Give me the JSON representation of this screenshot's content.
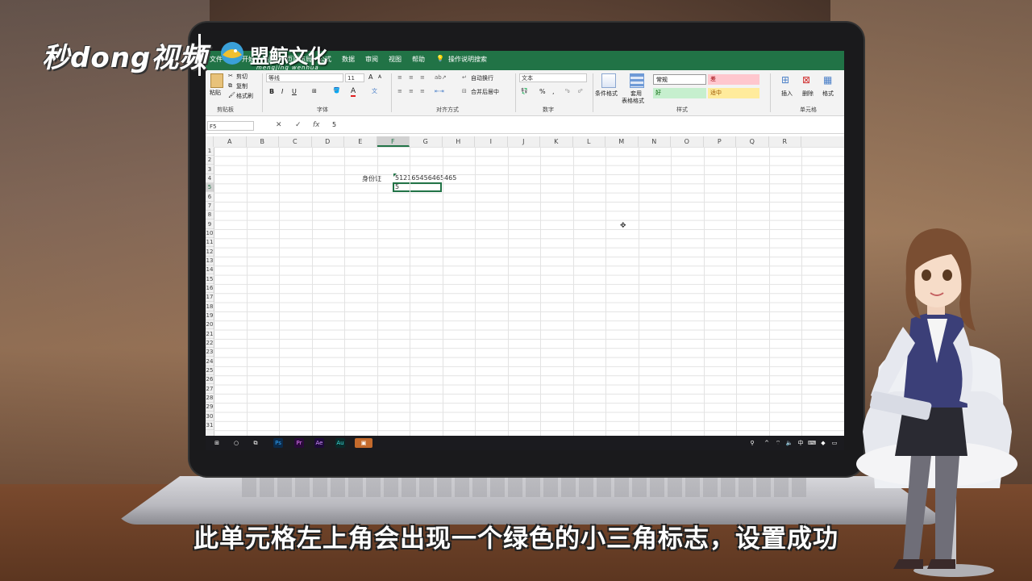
{
  "overlay": {
    "channel_logo": "秒dong视频",
    "brand_name": "盟鲸文化",
    "brand_sub": "mengjing wenhua",
    "subtitle": "此单元格左上角会出现一个绿色的小三角标志，设置成功"
  },
  "excel": {
    "tabs": [
      "文件",
      "开始",
      "插入",
      "页面布局",
      "公式",
      "数据",
      "审阅",
      "视图",
      "帮助"
    ],
    "tell_me": "操作说明搜索",
    "clipboard": {
      "paste": "粘贴",
      "cut": "剪切",
      "copy": "复制",
      "format_painter": "格式刷",
      "label": "剪贴板"
    },
    "font": {
      "name": "等线",
      "size": "11",
      "bold": "B",
      "italic": "I",
      "underline": "U",
      "font_color": "A",
      "grow": "A",
      "shrink": "A",
      "label": "字体"
    },
    "alignment": {
      "wrap": "自动换行",
      "merge": "合并后居中",
      "label": "对齐方式"
    },
    "number": {
      "format": "文本",
      "percent": "%",
      "comma": ",",
      "label": "数字"
    },
    "styles": {
      "conditional": "条件格式",
      "table_format_1": "套用",
      "table_format_2": "表格格式",
      "normal": "常规",
      "bad": "差",
      "good": "好",
      "neutral": "适中",
      "label": "样式"
    },
    "cells": {
      "insert": "插入",
      "delete": "删除",
      "format": "格式",
      "label": "单元格"
    },
    "name_box": "F5",
    "formula_cancel": "✕",
    "formula_enter": "✓",
    "formula_fx": "fx",
    "formula_value": "5",
    "columns": [
      "A",
      "B",
      "C",
      "D",
      "E",
      "F",
      "G",
      "H",
      "I",
      "J",
      "K",
      "L",
      "M",
      "N",
      "O",
      "P",
      "Q",
      "R"
    ],
    "rows": [
      "1",
      "2",
      "3",
      "4",
      "5",
      "6",
      "7",
      "8",
      "9",
      "10",
      "11",
      "12",
      "13",
      "14",
      "15",
      "16",
      "17",
      "18",
      "19",
      "20",
      "21",
      "22",
      "23",
      "24",
      "25",
      "26",
      "27",
      "28",
      "29",
      "30",
      "31"
    ],
    "cell_e4": "身份证",
    "cell_f4": "512165456465465",
    "cell_f5": "5"
  },
  "taskbar": {
    "apps": [
      "Ps",
      "Pr",
      "Ae",
      "Au"
    ]
  },
  "colors": {
    "excel_green": "#217346",
    "taskbar": "#1b1b1f"
  }
}
